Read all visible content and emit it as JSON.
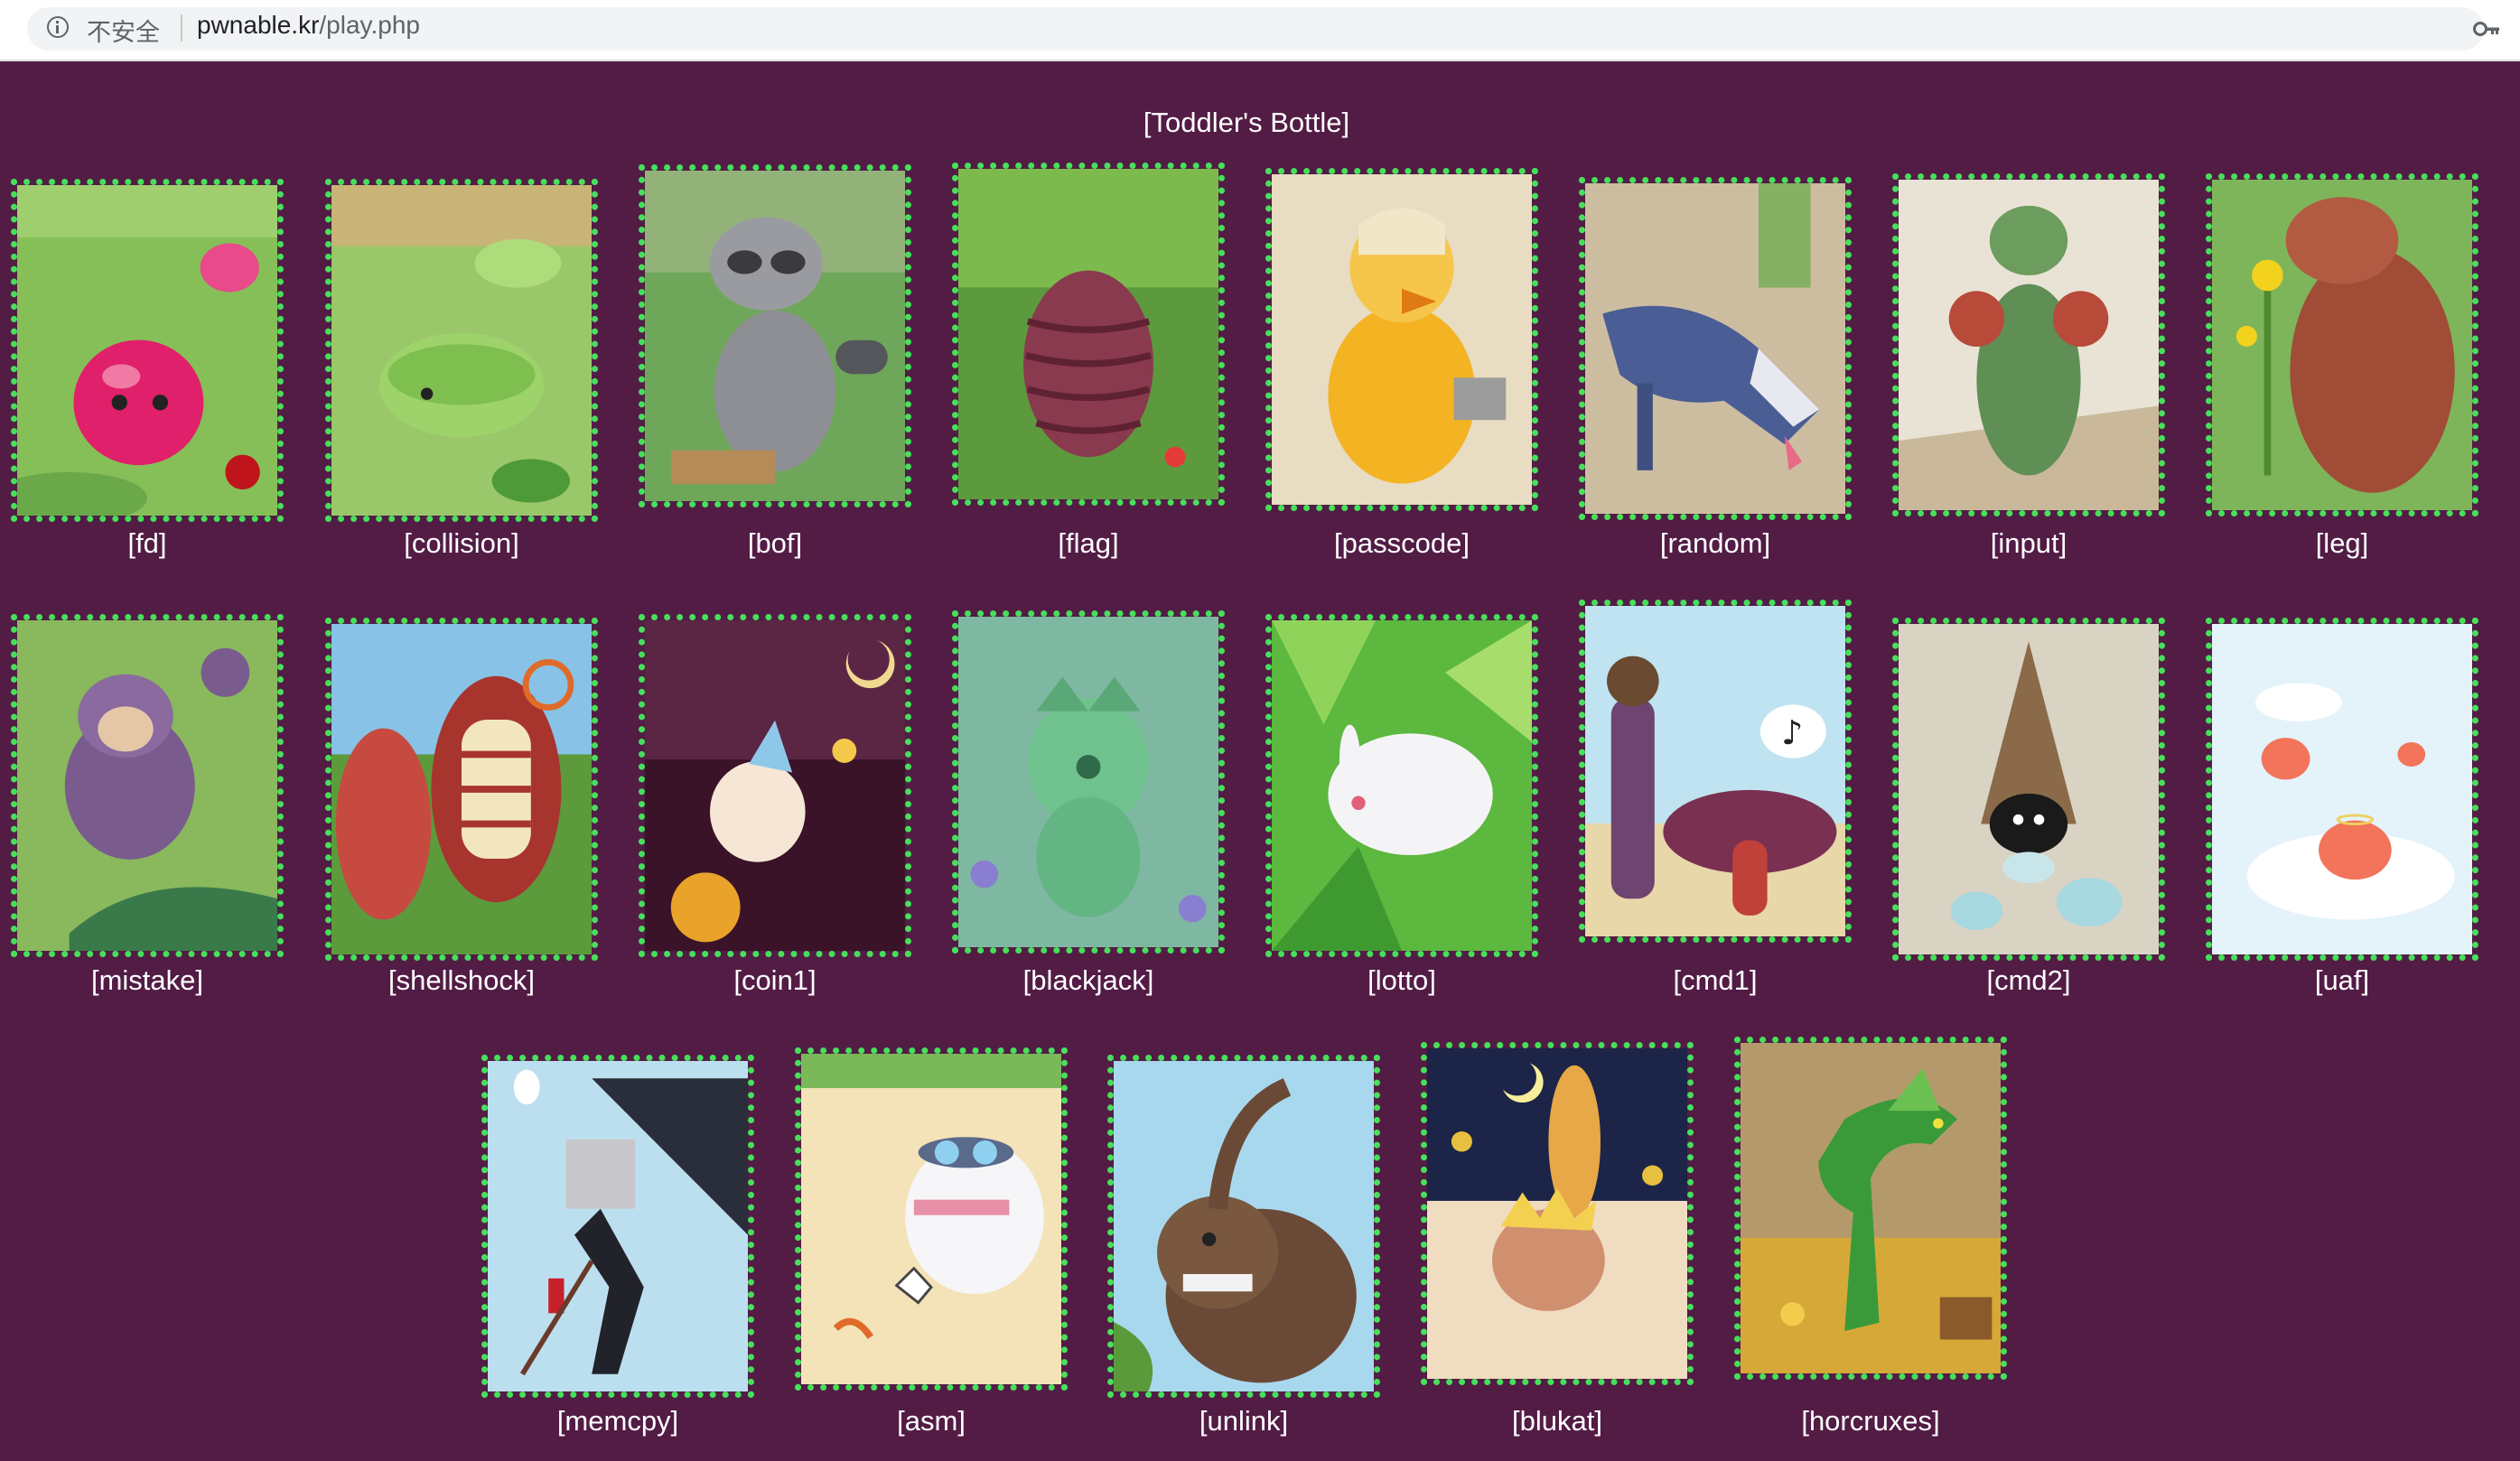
{
  "browser": {
    "security_label": "不安全",
    "url_host": "pwnable.kr",
    "url_path": "/play.php"
  },
  "section_title": "[Toddler's Bottle]",
  "challenges": [
    {
      "label": "[fd]",
      "creature": "pink-slime"
    },
    {
      "label": "[collision]",
      "creature": "green-caterpillar"
    },
    {
      "label": "[bof]",
      "creature": "raccoon"
    },
    {
      "label": "[flag]",
      "creature": "cocoon"
    },
    {
      "label": "[passcode]",
      "creature": "yellow-bird"
    },
    {
      "label": "[random]",
      "creature": "blue-wolf"
    },
    {
      "label": "[input]",
      "creature": "green-cricket"
    },
    {
      "label": "[leg]",
      "creature": "brown-bear"
    },
    {
      "label": "[mistake]",
      "creature": "purple-monkey"
    },
    {
      "label": "[shellshock]",
      "creature": "venus-flytrap"
    },
    {
      "label": "[coin1]",
      "creature": "ghost-lantern"
    },
    {
      "label": "[blackjack]",
      "creature": "green-frog"
    },
    {
      "label": "[lotto]",
      "creature": "white-rabbit"
    },
    {
      "label": "[cmd1]",
      "creature": "girl-mushroom"
    },
    {
      "label": "[cmd2]",
      "creature": "hooded-shell"
    },
    {
      "label": "[uaf]",
      "creature": "pink-slime-clouds"
    },
    {
      "label": "[memcpy]",
      "creature": "bucket-knight"
    },
    {
      "label": "[asm]",
      "creature": "goggle-bird"
    },
    {
      "label": "[unlink]",
      "creature": "rhino-beetle"
    },
    {
      "label": "[blukat]",
      "creature": "club-kid"
    },
    {
      "label": "[horcruxes]",
      "creature": "green-lizard"
    }
  ]
}
